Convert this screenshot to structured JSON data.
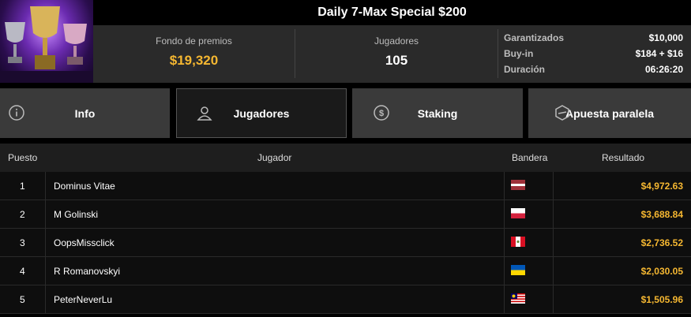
{
  "header": {
    "title": "Daily 7-Max Special $200",
    "prize_pool_label": "Fondo de premios",
    "prize_pool_value": "$19,320",
    "players_label": "Jugadores",
    "players_value": "105",
    "details": [
      {
        "key": "Garantizados",
        "value": "$10,000"
      },
      {
        "key": "Buy-in",
        "value": "$184 + $16"
      },
      {
        "key": "Duración",
        "value": "06:26:20"
      }
    ]
  },
  "tabs": [
    {
      "label": "Info",
      "icon": "info-icon"
    },
    {
      "label": "Jugadores",
      "icon": "user-icon",
      "active": true
    },
    {
      "label": "Staking",
      "icon": "staking-icon"
    },
    {
      "label": "Apuesta paralela",
      "icon": "side-bet-icon"
    }
  ],
  "table": {
    "columns": [
      "Puesto",
      "Jugador",
      "Bandera",
      "Resultado"
    ],
    "rows": [
      {
        "pos": "1",
        "player": "Dominus Vitae",
        "flag": "latvia",
        "result": "$4,972.63"
      },
      {
        "pos": "2",
        "player": "M Golinski",
        "flag": "poland",
        "result": "$3,688.84"
      },
      {
        "pos": "3",
        "player": "OopsMissclick",
        "flag": "peru",
        "result": "$2,736.52"
      },
      {
        "pos": "4",
        "player": "R Romanovskyi",
        "flag": "ukraine",
        "result": "$2,030.05"
      },
      {
        "pos": "5",
        "player": "PeterNeverLu",
        "flag": "malaysia",
        "result": "$1,505.96"
      }
    ]
  },
  "colors": {
    "accent": "#f5b731"
  }
}
